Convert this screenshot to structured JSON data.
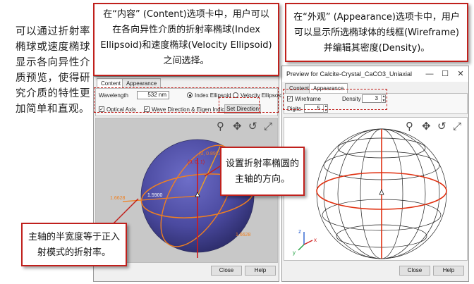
{
  "intro_text": "可以通过折射率椭球或速度椭球显示各向异性介质预览，使得研究介质的特性更加简单和直观。",
  "callouts": {
    "content": "在“内容” (Content)选项卡中，用户可以在各向异性介质的折射率椭球(Index Ellipsoid)和速度椭球(Velocity Ellipsoid)之间选择。",
    "appearance": "在“外观” (Appearance)选项卡中，用户可以显示所选椭球体的线框(Wireframe)并编辑其密度(Density)。",
    "direction": "设置折射率椭圆的主轴的方向。",
    "half_width": "主轴的半宽度等于正入射模式的折射率。"
  },
  "left_window": {
    "tabs": [
      "Content",
      "Appearance"
    ],
    "wavelength_label": "Wavelength",
    "wavelength_value": "532 nm",
    "index_ellipsoid_label": "Index Ellipsoid",
    "velocity_ellipsoid_label": "Velocity Ellipsoid",
    "optical_axis_label": "Optical Axis",
    "wave_direction_label": "Wave Direction & Eigen Indices",
    "set_direction_label": "Set Direction",
    "close_label": "Close",
    "help_label": "Help",
    "annotations": {
      "coord_top": "(0, 0.89236, 0.45126)",
      "axis_label": "(0, 0, 1)",
      "left_value": "1.6628",
      "mid_value": "1.5900",
      "bottom_value": "1.6628"
    }
  },
  "right_window": {
    "title": "Preview for Calcite-Crystal_CaCO3_Uniaxial",
    "tabs": [
      "Content",
      "Appearance"
    ],
    "wireframe_label": "Wireframe",
    "density_label": "Density",
    "density_value": "3",
    "digits_label": "Digits",
    "digits_value": "5",
    "close_label": "Close",
    "help_label": "Help",
    "axes": {
      "x": "x",
      "y": "y",
      "z": "z"
    }
  },
  "colors": {
    "callout_border": "#c0201c",
    "ellipsoid_fill": "#4b4aa0",
    "annotation_orange": "#f08020",
    "axis_red": "#d01818"
  }
}
